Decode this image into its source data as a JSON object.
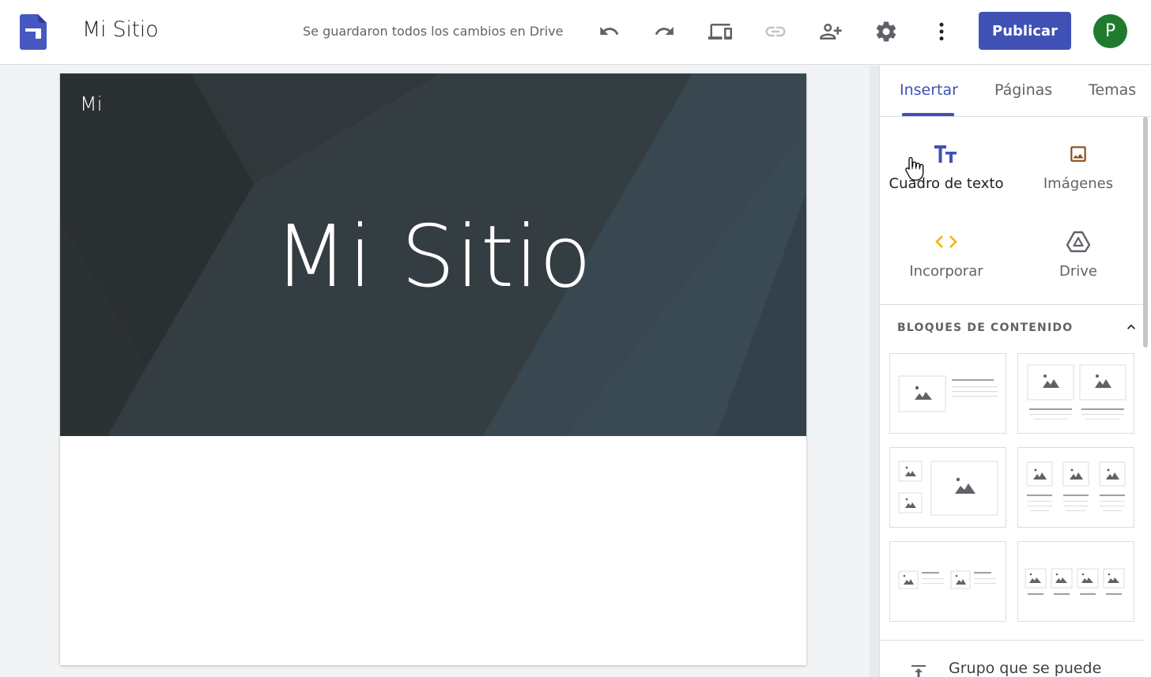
{
  "header": {
    "site_title": "Mi Sitio",
    "save_status": "Se guardaron todos los cambios en Drive",
    "publish_label": "Publicar",
    "avatar_initial": "P"
  },
  "canvas": {
    "banner_small_text": "Mi",
    "banner_title": "Mi Sitio"
  },
  "panel": {
    "tabs": [
      {
        "label": "Insertar",
        "active": true
      },
      {
        "label": "Páginas",
        "active": false
      },
      {
        "label": "Temas",
        "active": false
      }
    ],
    "insert_items": [
      {
        "label": "Cuadro de texto",
        "icon": "text-box-icon"
      },
      {
        "label": "Imágenes",
        "icon": "image-icon"
      },
      {
        "label": "Incorporar",
        "icon": "embed-icon"
      },
      {
        "label": "Drive",
        "icon": "drive-icon"
      }
    ],
    "section_title": "BLOQUES DE CONTENIDO",
    "drag_group_label": "Grupo que se puede"
  },
  "colors": {
    "accent": "#3f51b5",
    "avatar": "#1e7b2e",
    "banner": "#303638",
    "embed": "#f4b400",
    "image": "#8d4b16"
  }
}
